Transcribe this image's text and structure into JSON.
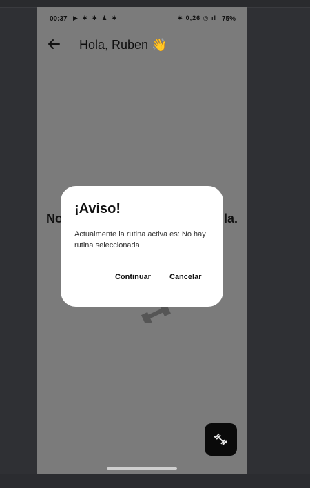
{
  "status_bar": {
    "time": "00:37",
    "left_icons": "▶ ✱ ✱ ♟ ✱",
    "right_icons": "✱ 0,26 ◎ ıl",
    "battery": "75%"
  },
  "app_bar": {
    "title": "Hola, Ruben 👋",
    "back_icon": "arrow-left-icon"
  },
  "background": {
    "text_left": "No",
    "text_right": "la."
  },
  "dialog": {
    "title": "¡Aviso!",
    "body": "Actualmente la rutina activa es: No hay rutina seleccionada",
    "continue_label": "Continuar",
    "cancel_label": "Cancelar"
  },
  "fab": {
    "icon": "dumbbell-icon"
  },
  "colors": {
    "scrim": "#7b7b7b",
    "dialog_bg": "#ffffff",
    "fab_bg": "#0a0a0a"
  }
}
